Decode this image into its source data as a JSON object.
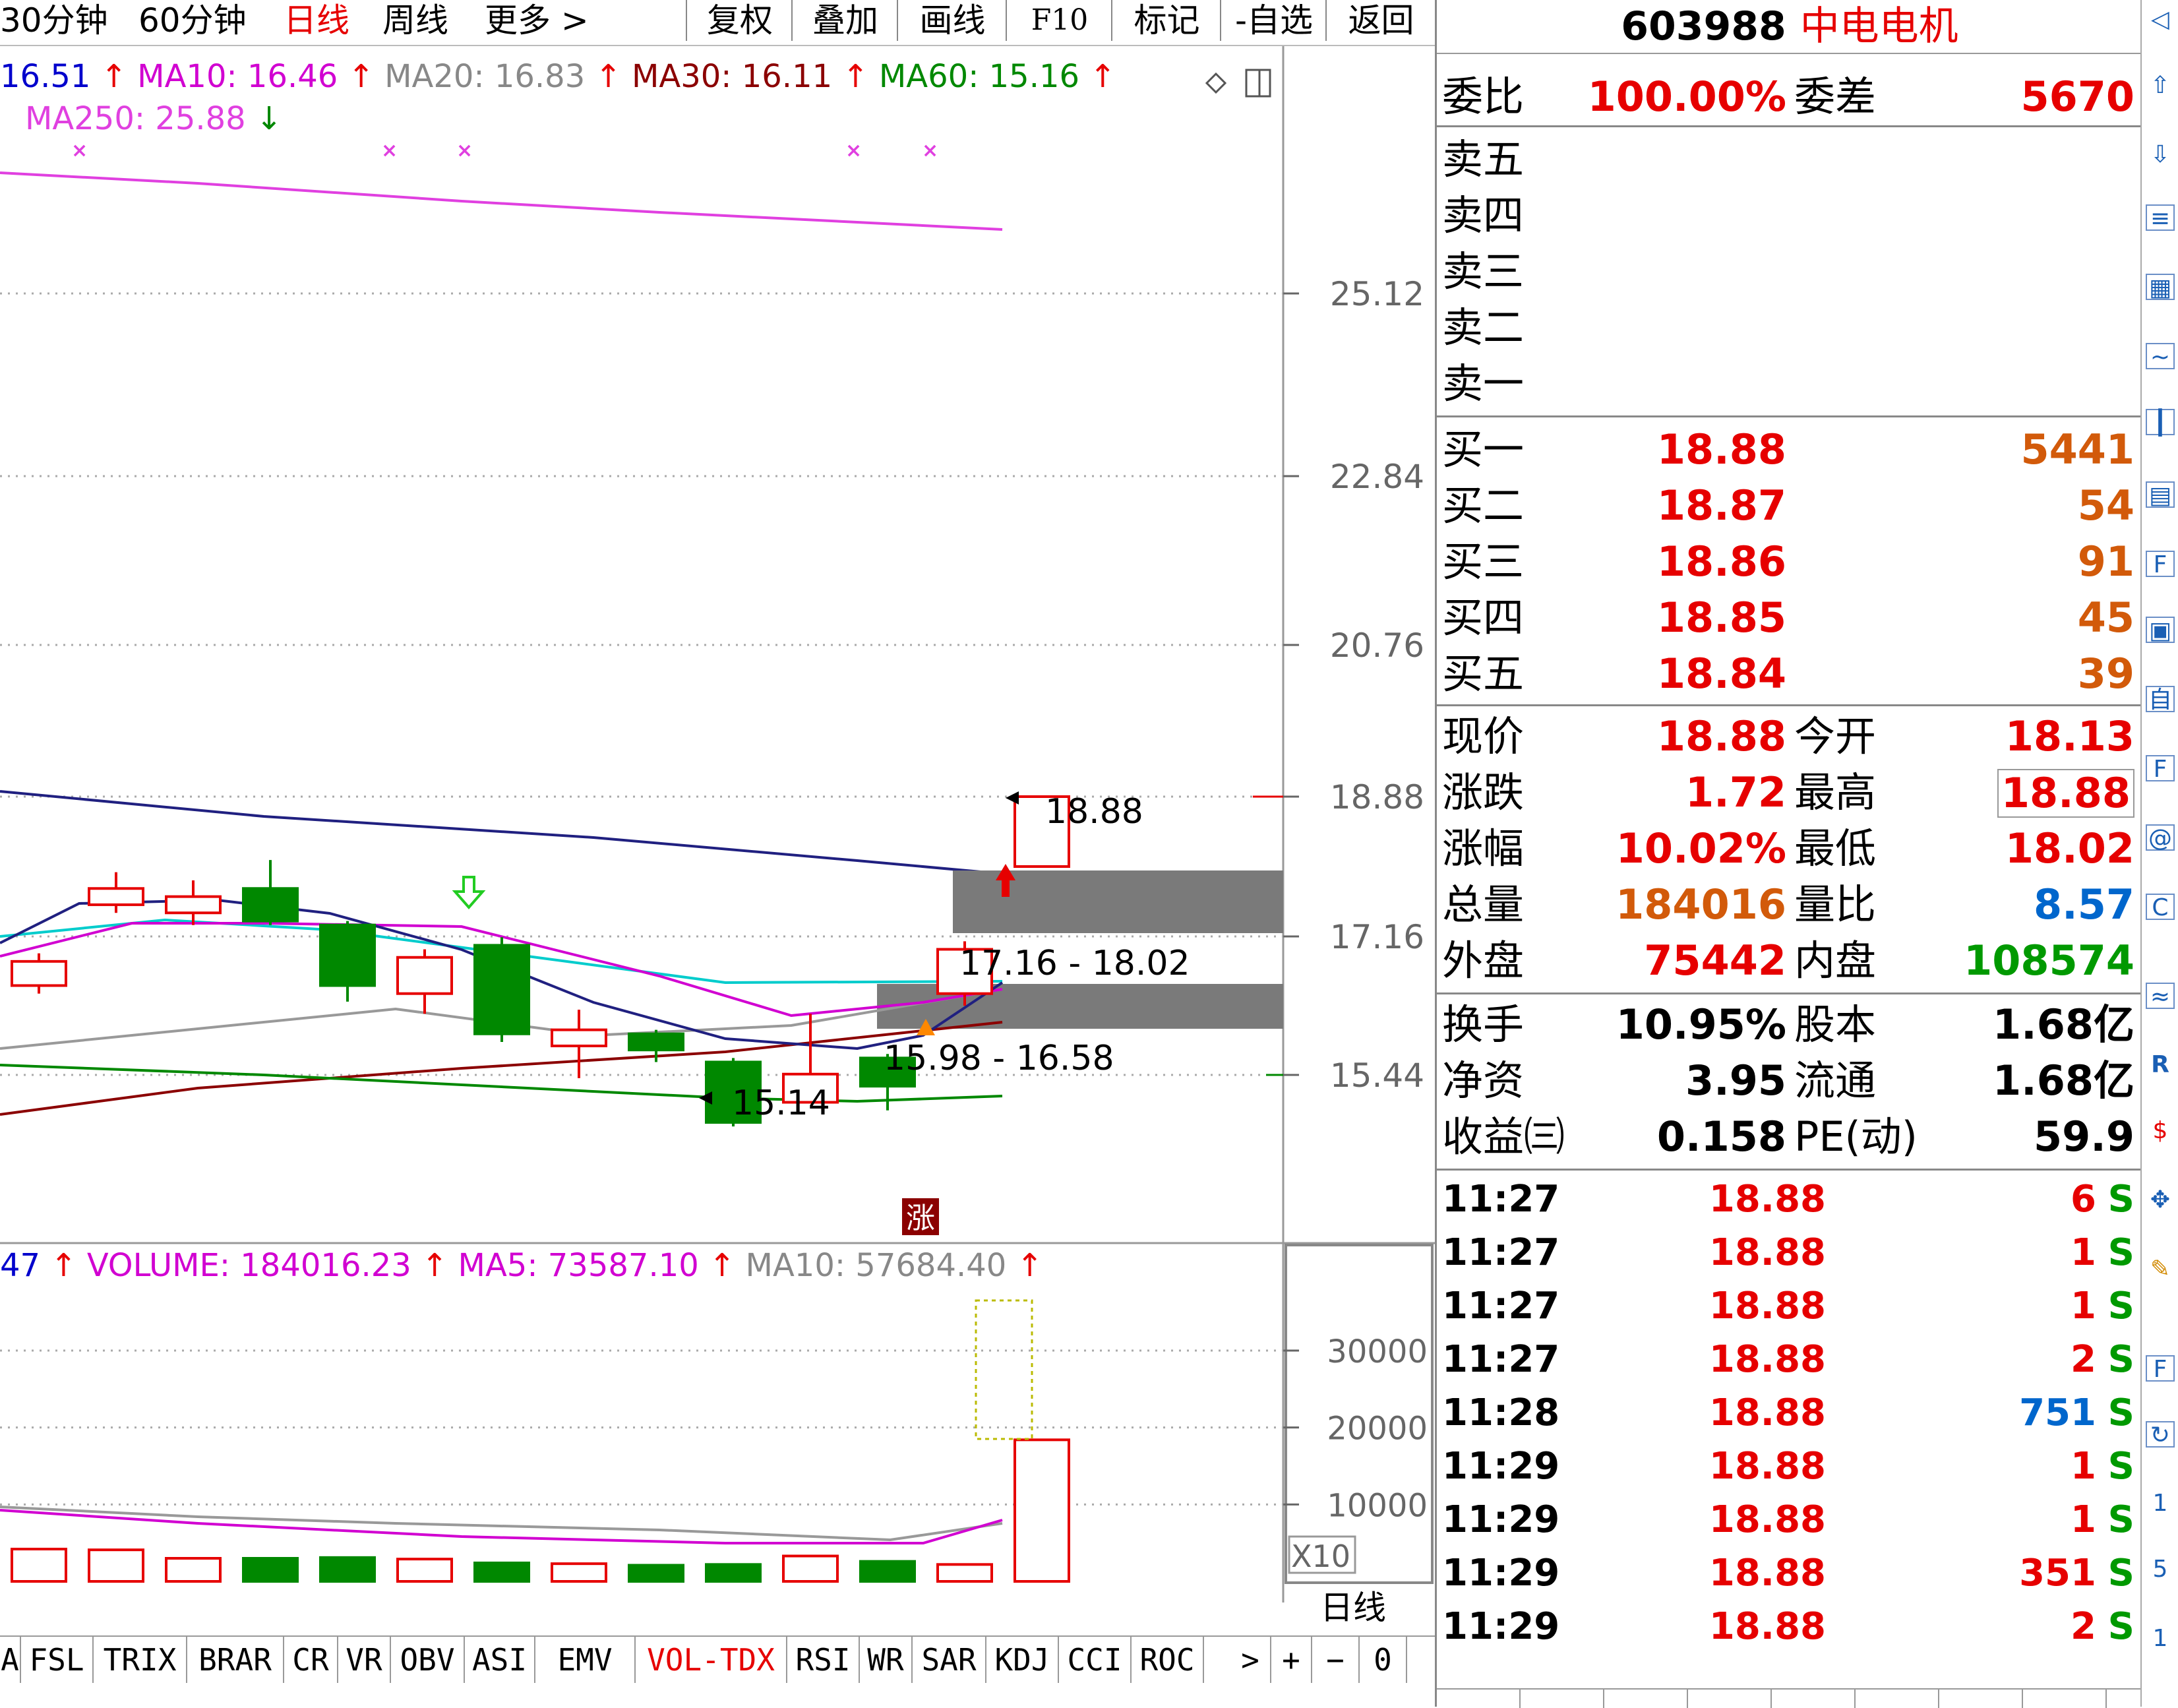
{
  "toolbar": {
    "periods": [
      "30分钟",
      "60分钟",
      "日线",
      "周线",
      "更多 >"
    ],
    "active_period": "日线",
    "buttons": [
      "复权",
      "叠加",
      "画线",
      "F10",
      "标记",
      "-自选",
      "返回"
    ]
  },
  "ma_legend": {
    "ma5": "16.51",
    "ma10": "MA10: 16.46",
    "ma20": "MA20: 16.83",
    "ma30": "MA30: 16.11",
    "ma60": "MA60: 15.16",
    "ma250": "MA250: 25.88"
  },
  "vol_legend": {
    "prefix": "47",
    "volume": "VOLUME: 184016.23",
    "ma5": "MA5: 73587.10",
    "ma10": "MA10: 57684.40"
  },
  "price_axis": [
    "25.12",
    "22.84",
    "20.76",
    "18.88",
    "17.16",
    "15.44"
  ],
  "volume_axis": [
    "30000",
    "20000",
    "10000"
  ],
  "volume_unit": "X10",
  "chart_period_label": "日线",
  "annotations": {
    "last_price": "18.88",
    "zone_upper": "17.16 - 18.02",
    "zone_lower": "15.98 - 16.58",
    "low_mark": "15.14",
    "limit_up_badge": "涨"
  },
  "chart_data": {
    "type": "candlestick",
    "price_ticks": [
      25.12,
      22.84,
      20.76,
      18.88,
      17.16,
      15.44
    ],
    "candles": [
      {
        "o": 16.55,
        "c": 16.85,
        "h": 16.95,
        "l": 16.45,
        "up": true
      },
      {
        "o": 17.55,
        "c": 17.75,
        "h": 17.95,
        "l": 17.45,
        "up": true
      },
      {
        "o": 17.45,
        "c": 17.65,
        "h": 17.85,
        "l": 17.3,
        "up": true
      },
      {
        "o": 17.75,
        "c": 17.35,
        "h": 18.1,
        "l": 17.3,
        "up": false
      },
      {
        "o": 17.3,
        "c": 16.55,
        "h": 17.35,
        "l": 16.35,
        "up": false
      },
      {
        "o": 16.45,
        "c": 16.9,
        "h": 17.0,
        "l": 16.2,
        "up": true
      },
      {
        "o": 17.05,
        "c": 15.95,
        "h": 17.15,
        "l": 15.85,
        "up": false
      },
      {
        "o": 15.8,
        "c": 16.0,
        "h": 16.25,
        "l": 15.4,
        "up": true
      },
      {
        "o": 15.95,
        "c": 15.75,
        "h": 16.0,
        "l": 15.6,
        "up": false
      },
      {
        "o": 15.6,
        "c": 14.85,
        "h": 15.65,
        "l": 14.8,
        "up": false
      },
      {
        "o": 15.1,
        "c": 15.45,
        "h": 16.2,
        "l": 15.1,
        "up": true
      },
      {
        "o": 15.65,
        "c": 15.3,
        "h": 15.7,
        "l": 15.0,
        "up": false
      },
      {
        "o": 16.45,
        "c": 17.0,
        "h": 17.1,
        "l": 16.3,
        "up": true
      },
      {
        "o": 18.02,
        "c": 18.88,
        "h": 18.88,
        "l": 18.02,
        "up": true
      }
    ],
    "volumes": [
      4200,
      4100,
      3000,
      3000,
      3100,
      2900,
      2400,
      2300,
      2100,
      2200,
      3300,
      2600,
      2200,
      18400
    ],
    "volume_ticks": [
      30000,
      20000,
      10000
    ]
  },
  "quote": {
    "code": "603988",
    "name": "中电电机",
    "weibi_label": "委比",
    "weibi": "100.00%",
    "weicha_label": "委差",
    "weicha": "5670",
    "asks": [
      "卖五",
      "卖四",
      "卖三",
      "卖二",
      "卖一"
    ],
    "bids": [
      {
        "label": "买一",
        "price": "18.88",
        "vol": "5441"
      },
      {
        "label": "买二",
        "price": "18.87",
        "vol": "54"
      },
      {
        "label": "买三",
        "price": "18.86",
        "vol": "91"
      },
      {
        "label": "买四",
        "price": "18.85",
        "vol": "45"
      },
      {
        "label": "买五",
        "price": "18.84",
        "vol": "39"
      }
    ],
    "stats": [
      {
        "l1": "现价",
        "v1": "18.88",
        "c1": "red",
        "l2": "今开",
        "v2": "18.13",
        "c2": "red"
      },
      {
        "l1": "涨跌",
        "v1": "1.72",
        "c1": "red",
        "l2": "最高",
        "v2": "18.88",
        "c2": "red"
      },
      {
        "l1": "涨幅",
        "v1": "10.02%",
        "c1": "red",
        "l2": "最低",
        "v2": "18.02",
        "c2": "red"
      },
      {
        "l1": "总量",
        "v1": "184016",
        "c1": "orange",
        "l2": "量比",
        "v2": "8.57",
        "c2": "blue"
      },
      {
        "l1": "外盘",
        "v1": "75442",
        "c1": "red",
        "l2": "内盘",
        "v2": "108574",
        "c2": "green"
      }
    ],
    "fundamentals": [
      {
        "l1": "换手",
        "v1": "10.95%",
        "l2": "股本",
        "v2": "1.68亿"
      },
      {
        "l1": "净资",
        "v1": "3.95",
        "l2": "流通",
        "v2": "1.68亿"
      },
      {
        "l1": "收益㈢",
        "v1": "0.158",
        "l2": "PE(动)",
        "v2": "59.9"
      }
    ],
    "ticks": [
      {
        "time": "11:27",
        "price": "18.88",
        "vol": "6",
        "flag": "S",
        "vc": "red"
      },
      {
        "time": "11:27",
        "price": "18.88",
        "vol": "1",
        "flag": "S",
        "vc": "red"
      },
      {
        "time": "11:27",
        "price": "18.88",
        "vol": "1",
        "flag": "S",
        "vc": "red"
      },
      {
        "time": "11:27",
        "price": "18.88",
        "vol": "2",
        "flag": "S",
        "vc": "red"
      },
      {
        "time": "11:28",
        "price": "18.88",
        "vol": "751",
        "flag": "S",
        "vc": "blue"
      },
      {
        "time": "11:29",
        "price": "18.88",
        "vol": "1",
        "flag": "S",
        "vc": "red"
      },
      {
        "time": "11:29",
        "price": "18.88",
        "vol": "1",
        "flag": "S",
        "vc": "red"
      },
      {
        "time": "11:29",
        "price": "18.88",
        "vol": "351",
        "flag": "S",
        "vc": "red"
      },
      {
        "time": "11:29",
        "price": "18.88",
        "vol": "2",
        "flag": "S",
        "vc": "red"
      }
    ]
  },
  "indicator_tabs": [
    "A",
    "FSL",
    "TRIX",
    "BRAR",
    "CR",
    "VR",
    "OBV",
    "ASI",
    "EMV",
    "VOL-TDX",
    "RSI",
    "WR",
    "SAR",
    "KDJ",
    "CCI",
    "ROC",
    ">",
    "+",
    "−",
    "0"
  ],
  "active_indicator": "VOL-TDX",
  "colors": {
    "up": "#e60000",
    "down": "#008800",
    "ma5": "#000000",
    "ma10": "#d100d1",
    "ma20": "#888888",
    "ma30": "#8b0000",
    "ma60": "#008800",
    "ma250": "#e040e0",
    "mid_line": "#00cccc",
    "long_line": "#202080"
  }
}
